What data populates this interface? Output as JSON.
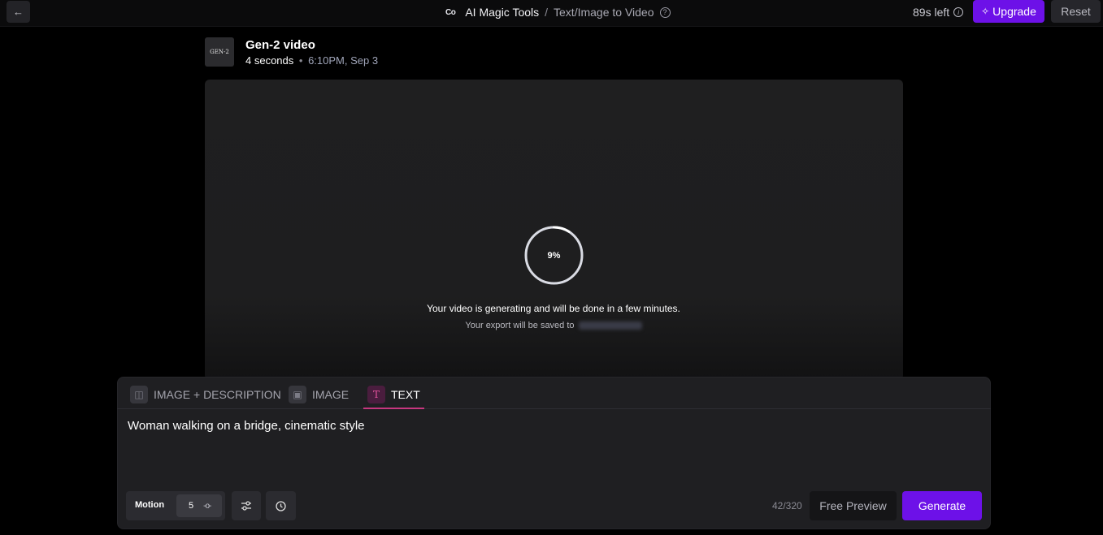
{
  "header": {
    "back_icon": "arrow-left-icon",
    "logo_text": "Co",
    "app_name": "AI Magic Tools",
    "separator": "/",
    "page_name": "Text/Image to Video",
    "time_left": "89s left",
    "upgrade_label": "Upgrade",
    "reset_label": "Reset",
    "accent_color": "#6d11e8"
  },
  "video": {
    "thumbnail_text": "GEN-2",
    "title": "Gen-2 video",
    "duration": "4 seconds",
    "meta_separator": "•",
    "timestamp": "6:10PM, Sep 3",
    "progress_percent": 9,
    "progress_label": "9%",
    "generating_message": "Your video is generating and will be done in a few minutes.",
    "save_message": "Your export will be saved to"
  },
  "prompt": {
    "tabs": [
      {
        "label": "IMAGE + DESCRIPTION",
        "icon": "image-description-icon",
        "active": false
      },
      {
        "label": "IMAGE",
        "icon": "image-icon",
        "active": false
      },
      {
        "label": "TEXT",
        "icon": "text-icon",
        "active": true
      }
    ],
    "text": "Woman walking on a bridge, cinematic style",
    "motion_label": "Motion",
    "motion_value": "5",
    "char_count": "42/320",
    "free_preview_label": "Free Preview",
    "generate_label": "Generate",
    "tab_accent_color": "#c7377f"
  }
}
